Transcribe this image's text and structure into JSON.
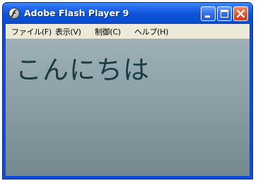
{
  "window": {
    "title": "Adobe Flash Player 9"
  },
  "menu": {
    "items": [
      {
        "label": "ファイル(F)"
      },
      {
        "label": "表示(V)"
      },
      {
        "label": "制御(C)"
      },
      {
        "label": "ヘルプ(H)"
      }
    ]
  },
  "content": {
    "text": "こんにちは"
  },
  "icons": {
    "app": "flash-player-icon",
    "minimize": "minimize-icon",
    "maximize": "maximize-icon",
    "close": "close-icon"
  },
  "colors": {
    "titlebar": "#0a4fd6",
    "menubar": "#ece9d8",
    "content_top": "#9fb1b7",
    "content_bottom": "#74888f",
    "text": "#173c44",
    "close_button": "#e25b35"
  }
}
